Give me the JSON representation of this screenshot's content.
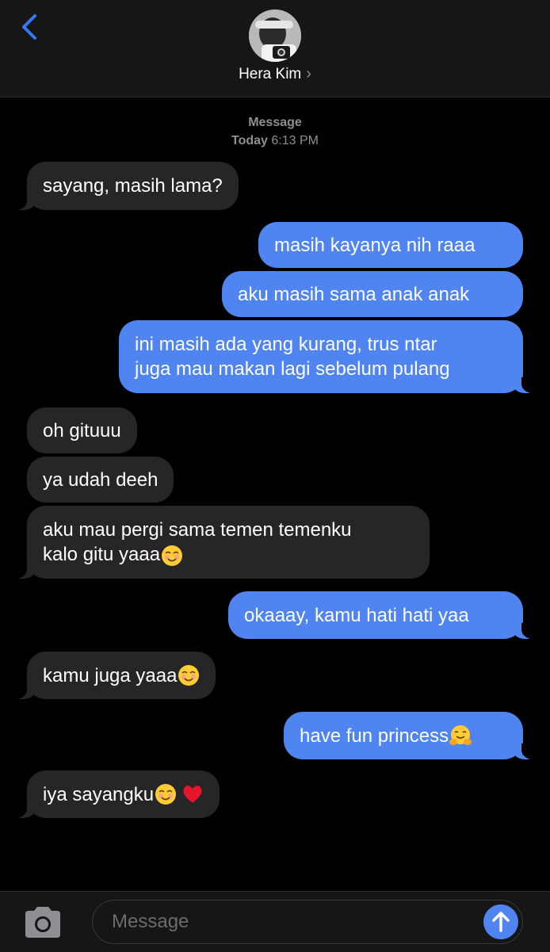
{
  "header": {
    "contact_name": "Hera Kim",
    "chevron": "›",
    "accent_color": "#3478f6"
  },
  "thread": {
    "service_label": "Message",
    "day_label": "Today",
    "time_label": "6:13 PM"
  },
  "messages": [
    {
      "side": "received",
      "lines": [
        "sayang, masih lama?"
      ]
    },
    {
      "side": "sent",
      "lines": [
        "masih kayanya nih raaa"
      ]
    },
    {
      "side": "sent",
      "lines": [
        "aku masih sama anak anak"
      ]
    },
    {
      "side": "sent",
      "lines": [
        "ini masih ada yang kurang, trus ntar",
        "juga mau makan lagi sebelum pulang"
      ]
    },
    {
      "side": "received",
      "lines": [
        "oh gituuu"
      ]
    },
    {
      "side": "received",
      "lines": [
        "ya udah deeh"
      ]
    },
    {
      "side": "received",
      "lines": [
        "aku mau pergi sama temen temenku",
        "kalo gitu yaaa"
      ],
      "emoji": [
        "smiling-face-emoji"
      ]
    },
    {
      "side": "sent",
      "lines": [
        "okaaay, kamu hati hati yaa"
      ]
    },
    {
      "side": "received",
      "lines": [
        "kamu juga yaaa"
      ],
      "emoji": [
        "smiling-face-emoji"
      ]
    },
    {
      "side": "sent",
      "lines": [
        "have fun princess"
      ],
      "emoji": [
        "hugging-face-emoji"
      ]
    },
    {
      "side": "received",
      "lines": [
        "iya sayangku"
      ],
      "emoji": [
        "smiling-face-emoji",
        "red-heart-emoji"
      ]
    }
  ],
  "compose": {
    "placeholder": "Message",
    "camera_icon": "camera-icon",
    "send_icon": "send-arrow-icon"
  },
  "colors": {
    "sent_bubble": "#4f84f1",
    "received_bubble": "#262628",
    "background": "#000000",
    "bar": "#161616"
  }
}
